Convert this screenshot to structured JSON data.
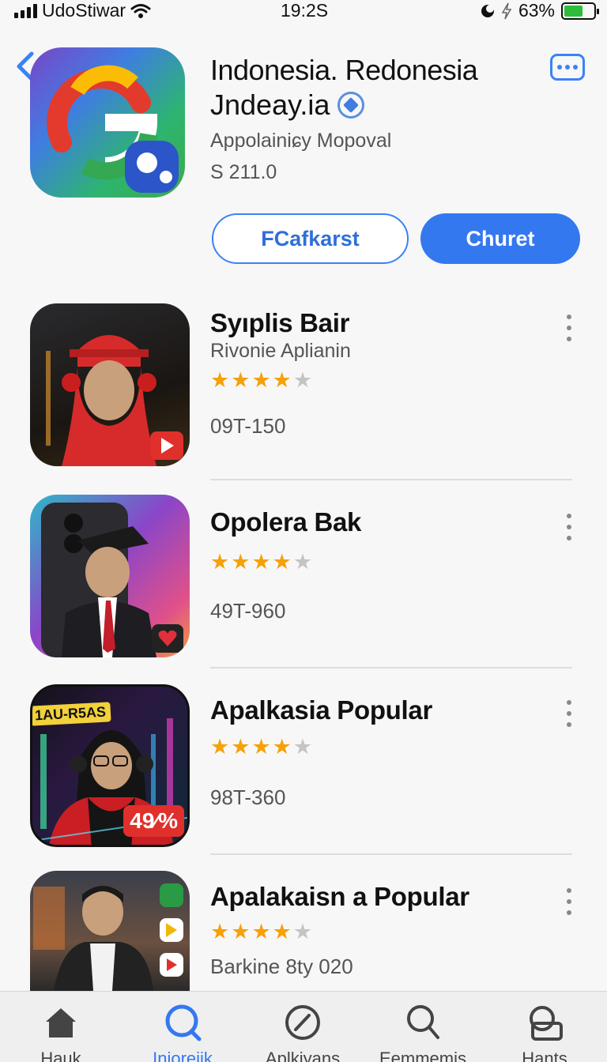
{
  "status_bar": {
    "carrier": "UdoStiwar",
    "time": "19:2S",
    "battery_percent": "63%",
    "battery_level": 0.63
  },
  "app": {
    "title_line1": "Indonesia. Redonesia",
    "title_line2": "Jndeay.ia",
    "developer": "Appolainiɕy Mopoval",
    "price": "S 211.0",
    "secondary_button": "FCafkarst",
    "primary_button": "Churet"
  },
  "colors": {
    "accent": "#3478f0",
    "star": "#f5a10a",
    "star_off": "#c4c4c4"
  },
  "list": [
    {
      "title": "Syıplis Bair",
      "subtitle": "Rivonie Aplianin",
      "rating": 4,
      "meta": "09T-150",
      "badge": "play-icon"
    },
    {
      "title": "Opolera Bak",
      "subtitle": "",
      "rating": 4,
      "meta": "49T-960",
      "badge": "heart-icon"
    },
    {
      "title": "Apalkasia Popular",
      "subtitle": "",
      "rating": 4,
      "meta": "98T-360",
      "badge_text": "49⁄%",
      "tag_text": "1AU-R5AS"
    },
    {
      "title": "Apalakaisn a Popular",
      "subtitle": "",
      "rating": 4,
      "meta": "Barkine 8ty 020"
    }
  ],
  "tabs": [
    {
      "label": "Hauk",
      "icon": "home-icon",
      "active": false
    },
    {
      "label": "Iniorejik",
      "icon": "search-icon",
      "active": true
    },
    {
      "label": "Aplkiyans",
      "icon": "compass-icon",
      "active": false
    },
    {
      "label": "Eemmemis",
      "icon": "search-icon",
      "active": false
    },
    {
      "label": "Hants",
      "icon": "chat-icon",
      "active": false
    }
  ]
}
